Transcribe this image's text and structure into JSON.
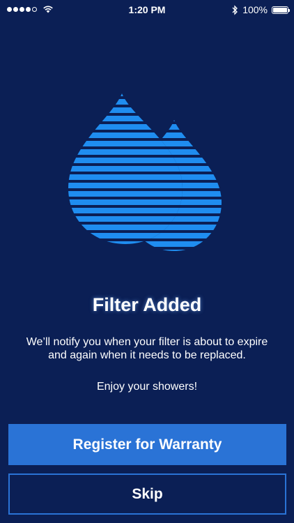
{
  "status_bar": {
    "time": "1:20 PM",
    "battery": "100%",
    "signal_bars": 4,
    "signal_total": 5,
    "battery_level": 1.0
  },
  "logo": {
    "icon": "water-drops-icon",
    "color": "#1f8df0"
  },
  "title": "Filter Added",
  "message": "We’ll notify you when your filter is about to expire and again when it needs to be replaced.",
  "enjoy": "Enjoy your showers!",
  "buttons": {
    "primary_label": "Register for Warranty",
    "secondary_label": "Skip"
  },
  "colors": {
    "background": "#0b1f55",
    "accent": "#2a73d6",
    "logo": "#1f8df0"
  }
}
